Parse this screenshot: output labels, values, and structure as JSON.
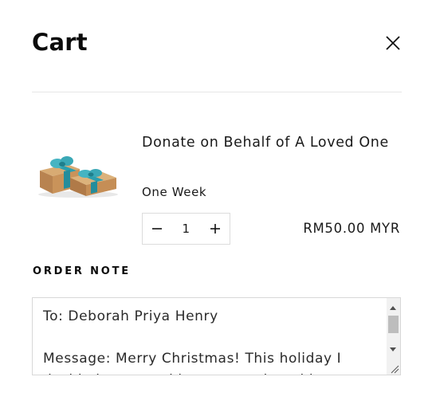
{
  "cart": {
    "title": "Cart",
    "close_icon": "close-icon"
  },
  "item": {
    "image_icon": "gift-box-image",
    "title": "Donate on Behalf of A Loved One",
    "variant": "One Week",
    "quantity": "1",
    "decrease_icon": "minus-icon",
    "increase_icon": "plus-icon",
    "price": "RM50.00 MYR"
  },
  "order_note": {
    "label": "ORDER NOTE",
    "value": "To: Deborah Priya Henry\n\nMessage: Merry Christmas! This holiday I decided to spread love, warmth and joy"
  },
  "colors": {
    "text": "#111111",
    "border": "#dcdcdc",
    "gift_wrap": "#c9935a",
    "ribbon": "#2a9fb0"
  }
}
